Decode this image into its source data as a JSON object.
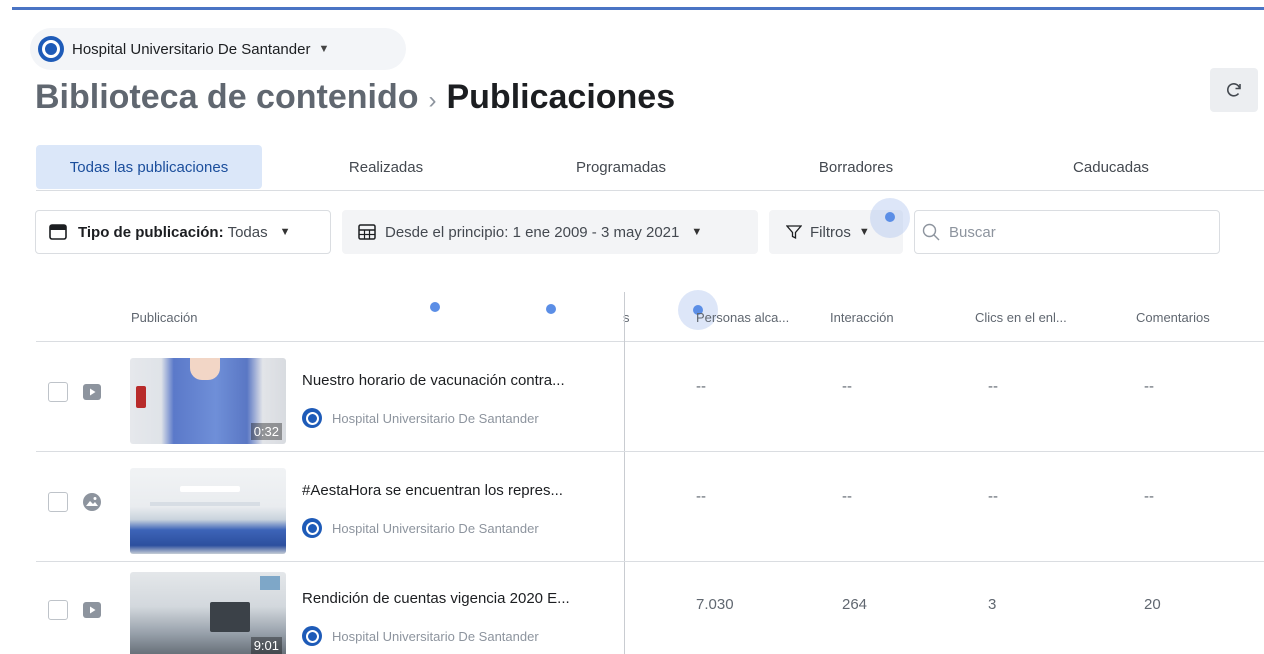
{
  "page": {
    "name": "Hospital Universitario De Santander",
    "brand_color": "#1e5bb8"
  },
  "header": {
    "breadcrumb_root": "Biblioteca de contenido",
    "breadcrumb_sep": "›",
    "title": "Publicaciones"
  },
  "tabs": [
    {
      "label": "Todas las publicaciones",
      "active": true
    },
    {
      "label": "Realizadas",
      "active": false
    },
    {
      "label": "Programadas",
      "active": false
    },
    {
      "label": "Borradores",
      "active": false
    },
    {
      "label": "Caducadas",
      "active": false
    }
  ],
  "filters": {
    "type_label": "Tipo de publicación:",
    "type_value": "Todas",
    "date_range": "Desde el principio: 1 ene 2009 - 3 may 2021",
    "filters_label": "Filtros",
    "search_placeholder": "Buscar"
  },
  "table": {
    "columns": [
      "Publicación",
      "s",
      "Personas alca...",
      "Interacción",
      "Clics en el enl...",
      "Comentarios"
    ],
    "rows": [
      {
        "type_icon": "video-icon",
        "title": "Nuestro horario de vacunación contra...",
        "author": "Hospital Universitario De Santander",
        "duration": "0:32",
        "reach": "--",
        "engagement": "--",
        "link_clicks": "--",
        "comments": "--"
      },
      {
        "type_icon": "photo-icon",
        "title": "#AestaHora se encuentran los repres...",
        "author": "Hospital Universitario De Santander",
        "duration": "",
        "reach": "--",
        "engagement": "--",
        "link_clicks": "--",
        "comments": "--"
      },
      {
        "type_icon": "video-icon",
        "title": "Rendición de cuentas vigencia 2020 E...",
        "author": "Hospital Universitario De Santander",
        "duration": "9:01",
        "reach": "7.030",
        "engagement": "264",
        "link_clicks": "3",
        "comments": "20"
      }
    ]
  },
  "colors": {
    "accent": "#4a74c4",
    "active_tab_bg": "#dbe7f9",
    "active_tab_text": "#1b4e9c"
  }
}
